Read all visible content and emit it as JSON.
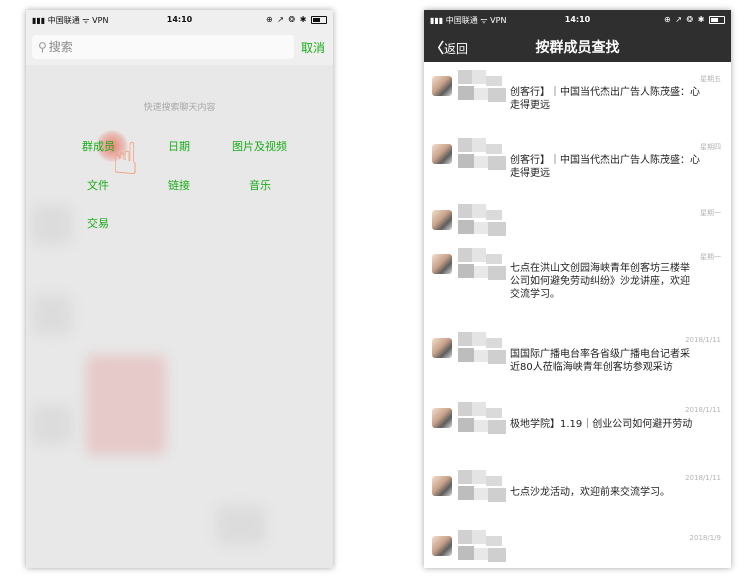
{
  "status_bar": {
    "carrier": "中国联通",
    "wifi": "ᯤ",
    "vpn": "VPN",
    "time": "14:10",
    "icons": "⊕ ↗ ❂ ✱"
  },
  "left": {
    "search_placeholder": "搜索",
    "cancel": "取消",
    "quick_title": "快速搜索聊天内容",
    "items": [
      "群成员",
      "日期",
      "图片及视频",
      "文件",
      "链接",
      "音乐",
      "交易"
    ]
  },
  "right": {
    "back": "返回",
    "title": "按群成员查找",
    "messages": [
      {
        "date": "星期五",
        "lines": [
          "创客行】｜中国当代杰出广告人陈茂盛：心",
          "走得更远"
        ]
      },
      {
        "date": "星期四",
        "lines": [
          "创客行】｜中国当代杰出广告人陈茂盛：心",
          "走得更远"
        ]
      },
      {
        "date": "星期一",
        "lines": []
      },
      {
        "date": "星期一",
        "lines": [
          "七点在洪山文创园海峡青年创客坊三楼举",
          "公司如何避免劳动纠纷》沙龙讲座，欢迎",
          "交流学习。"
        ]
      },
      {
        "date": "2018/1/11",
        "lines": [
          "国国际广播电台率各省级广播电台记者采",
          "近80人莅临海峡青年创客坊参观采访"
        ]
      },
      {
        "date": "2018/1/11",
        "lines": [
          "极地学院】1.19｜创业公司如何避开劳动"
        ]
      },
      {
        "date": "2018/1/11",
        "lines": [
          "七点沙龙活动，欢迎前来交流学习。"
        ]
      },
      {
        "date": "2018/1/9",
        "lines": []
      }
    ]
  },
  "colors": {
    "accent": "#1aad19",
    "nav": "#2f2f2f"
  }
}
